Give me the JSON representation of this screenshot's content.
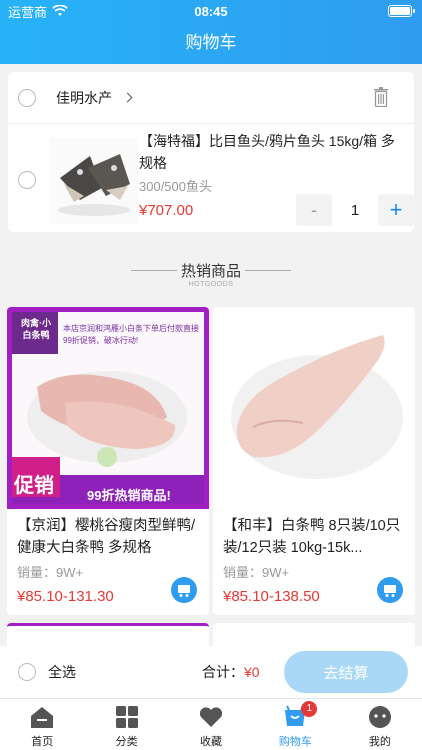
{
  "status": {
    "carrier": "运营商",
    "time": "08:45"
  },
  "nav": {
    "title": "购物车"
  },
  "store": {
    "name": "佳明水产"
  },
  "cart_item": {
    "title": "【海特福】比目鱼头/鸦片鱼头 15kg/箱 多规格",
    "spec": "300/500鱼头",
    "price": "¥707.00",
    "quantity": "1",
    "minus": "-",
    "plus": "+"
  },
  "hot": {
    "title": "热销商品",
    "subtitle": "HOTGOODS"
  },
  "products": [
    {
      "name": "【京润】樱桃谷瘦肉型鲜鸭/健康大白条鸭 多规格",
      "sales": "销量：9W+",
      "price": "¥85.10-131.30",
      "promo_tag": "肉禽·小白条鸭",
      "promo_text": "本店京润和鸿雁小白条下单后付款直接99折促销，破冰行动!",
      "promo_badge": "促销",
      "promo_banner": "99折热销商品!"
    },
    {
      "name": "【和丰】白条鸭 8只装/10只装/12只装 10kg-15k...",
      "sales": "销量：9W+",
      "price": "¥85.10-138.50"
    }
  ],
  "checkout": {
    "select_all": "全选",
    "total_label": "合计：",
    "total_value": "¥0",
    "button": "去结算"
  },
  "tabs": [
    {
      "label": "首页",
      "icon": "home-icon"
    },
    {
      "label": "分类",
      "icon": "category-icon"
    },
    {
      "label": "收藏",
      "icon": "heart-icon"
    },
    {
      "label": "购物车",
      "icon": "cart-icon",
      "badge": "1"
    },
    {
      "label": "我的",
      "icon": "profile-icon"
    }
  ],
  "colors": {
    "primary": "#2f9cf0",
    "price": "#e53935",
    "promo_purple": "#a21fc4"
  }
}
